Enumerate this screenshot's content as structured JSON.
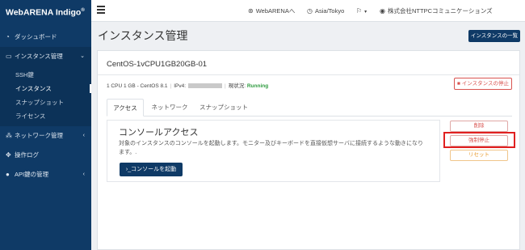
{
  "brand": {
    "name": "WebARENA Indigo",
    "mark": "®"
  },
  "header": {
    "links": [
      {
        "icon": "globe-icon",
        "label": "WebARENAへ"
      },
      {
        "icon": "clock-icon",
        "label": "Asia/Tokyo"
      },
      {
        "icon": "language-icon",
        "label": ""
      },
      {
        "icon": "user-icon",
        "label": "株式会社NTTPCコミュニケーションズ"
      }
    ]
  },
  "sidebar": {
    "items": [
      {
        "icon": "dashboard-icon",
        "label": "ダッシュボード"
      },
      {
        "icon": "monitor-icon",
        "label": "インスタンス管理",
        "chevron": "⌄"
      },
      {
        "icon": "network-icon",
        "label": "ネットワーク管理",
        "chevron": "‹"
      },
      {
        "icon": "log-icon",
        "label": "操作ログ"
      },
      {
        "icon": "key-icon",
        "label": "API鍵の管理",
        "chevron": "‹"
      }
    ],
    "submenu": [
      "SSH鍵",
      "インスタンス",
      "スナップショット",
      "ライセンス"
    ]
  },
  "page": {
    "title": "インスタンス管理",
    "list_button": "インスタンスの一覧"
  },
  "instance": {
    "name": "CentOS-1vCPU1GB20GB-01",
    "spec": "1 CPU 1 GB - CentOS 8.1",
    "ipv4_label": "IPv4:",
    "status_label": "現状況:",
    "status": "Running",
    "stop_button": "インスタンスの停止"
  },
  "tabs": [
    "アクセス",
    "ネットワーク",
    "スナップショット"
  ],
  "console": {
    "title": "コンソールアクセス",
    "description": "対象のインスタンスのコンソールを起動します。モニター及びキーボードを直接仮想サーバに接続するような動きになります。.",
    "launch_button": "›_コンソールを起動"
  },
  "actions": {
    "delete": "削除",
    "force_stop": "強制停止",
    "reset": "リセット"
  },
  "colors": {
    "navy": "#0f3a66",
    "danger": "#d9534f",
    "warning": "#e89a2c",
    "running": "#2e9b3f",
    "highlight": "#e02020"
  }
}
